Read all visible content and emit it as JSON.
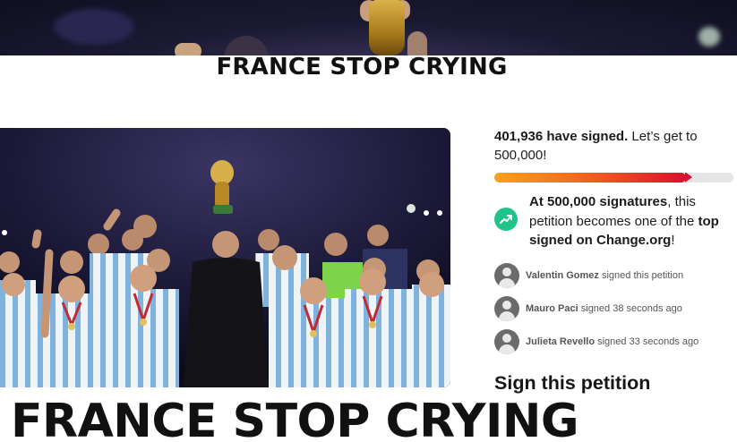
{
  "headline_top": "FRANCE STOP CRYING",
  "headline_bottom": "FRANCE STOP CRYING",
  "petition": {
    "signed_count": "401,936 have signed.",
    "goal_text": " Let’s get to 500,000!",
    "progress_fraction": 0.8,
    "milestone": {
      "bold_1": "At 500,000 signatures",
      "text_1": ", this petition becomes one of the ",
      "bold_2": "top signed on Change.org",
      "text_2": "!"
    },
    "signers": [
      {
        "name": "Valentin Gomez",
        "action": " signed this petition"
      },
      {
        "name": "Mauro Paci",
        "action": " signed 38 seconds ago"
      },
      {
        "name": "Julieta Revello",
        "action": " signed 33 seconds ago"
      }
    ],
    "sign_title": "Sign this petition"
  },
  "colors": {
    "progress_start": "#f9a31c",
    "progress_end": "#d7122d",
    "milestone_icon": "#1ec48a",
    "avatar": "#6b6b6e"
  }
}
